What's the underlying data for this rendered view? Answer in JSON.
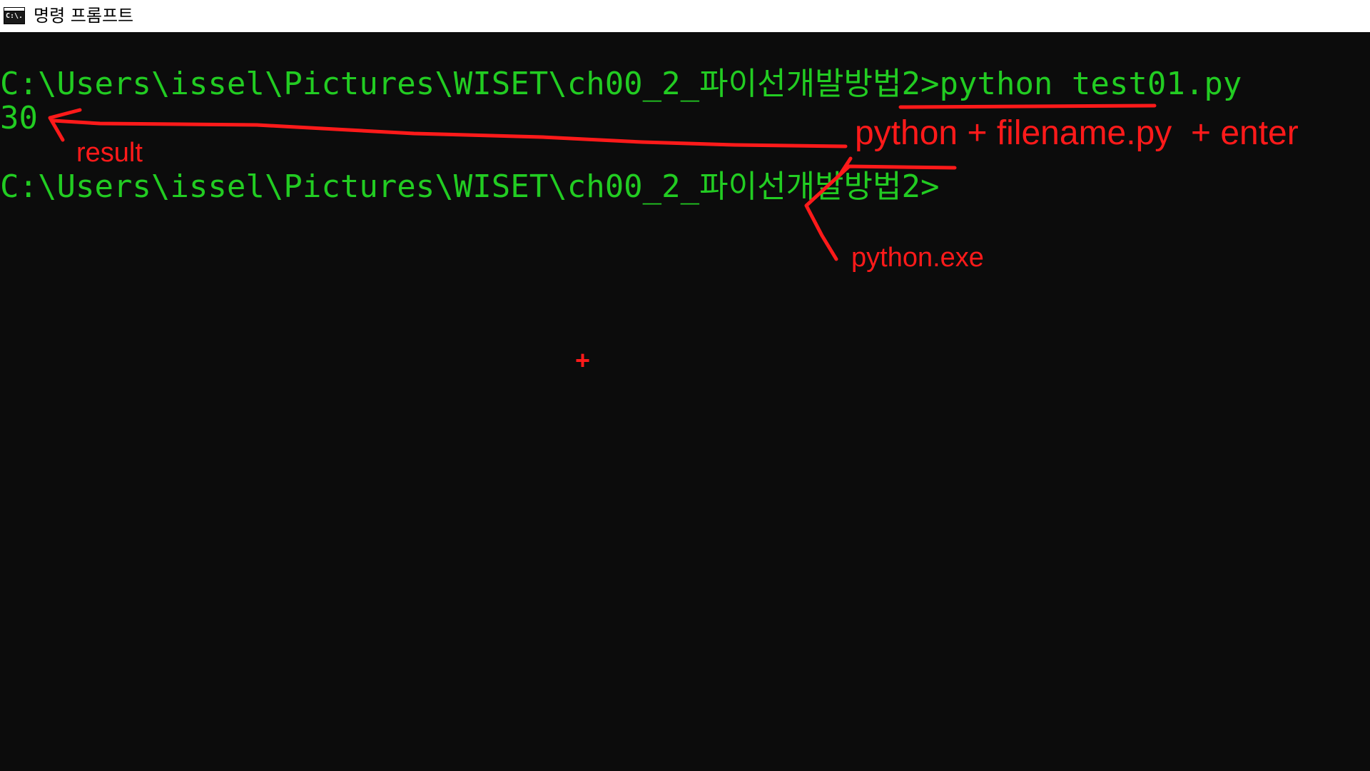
{
  "window": {
    "title": "명령 프롬프트",
    "icon": "cmd-icon",
    "icon_text": "C:\\."
  },
  "console": {
    "text_color": "#22cc22",
    "background": "#0c0c0c",
    "lines": [
      {
        "prompt": "C:\\Users\\issel\\Pictures\\WISET\\ch00_2_파이선개발방법2>",
        "command": "python test01.py"
      },
      {
        "output": "30"
      },
      {
        "prompt": "C:\\Users\\issel\\Pictures\\WISET\\ch00_2_파이선개발방법2>",
        "command": ""
      }
    ]
  },
  "annotations": {
    "color": "#ff1a1a",
    "command_hint": "python + filename.py  + enter",
    "result_label": "result",
    "exe_label": "python.exe",
    "cursor_mark": "+"
  }
}
